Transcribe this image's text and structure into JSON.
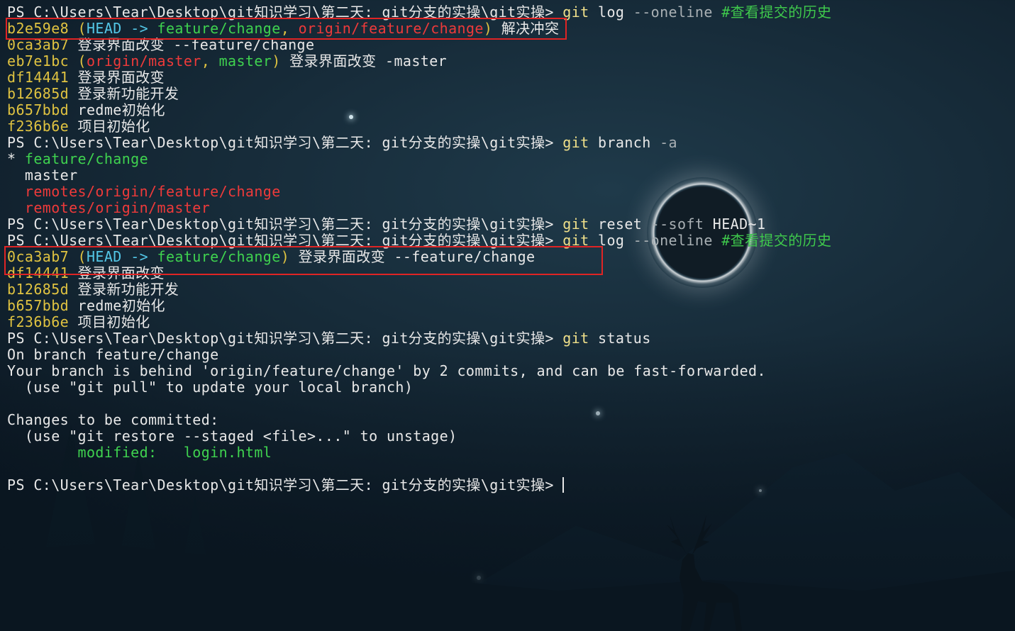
{
  "terminal": {
    "prompt": "PS C:\\Users\\Tear\\Desktop\\git知识学习\\第二天: git分支的实操\\git实操>",
    "lines": [
      {
        "type": "cmd",
        "cmd": "git",
        "args": " log",
        "param": " --oneline",
        "comment": " #查看提交的历史"
      },
      {
        "type": "log",
        "hash": "b2e59e8",
        "refs_open": " (",
        "head": "HEAD",
        "arrow": " -> ",
        "branch": "feature/change",
        "sep1": ", ",
        "remote1": "origin/feature/change",
        "refs_close": ")",
        "msg": " 解决冲突"
      },
      {
        "type": "plain_hash",
        "hash": "0ca3ab7",
        "msg": " 登录界面改变 --feature/change"
      },
      {
        "type": "log2",
        "hash": "eb7e1bc",
        "refs_open": " (",
        "remote": "origin/master",
        "sep": ", ",
        "local": "master",
        "refs_close": ")",
        "msg": " 登录界面改变 -master"
      },
      {
        "type": "plain_hash",
        "hash": "df14441",
        "msg": " 登录界面改变"
      },
      {
        "type": "plain_hash",
        "hash": "b12685d",
        "msg": " 登录新功能开发"
      },
      {
        "type": "plain_hash",
        "hash": "b657bbd",
        "msg": " redme初始化"
      },
      {
        "type": "plain_hash",
        "hash": "f236b6e",
        "msg": " 项目初始化"
      },
      {
        "type": "cmd",
        "cmd": "git",
        "args": " branch",
        "param": " -a",
        "comment": ""
      },
      {
        "type": "branch_current",
        "star": "* ",
        "name": "feature/change"
      },
      {
        "type": "branch_plain",
        "name": "  master"
      },
      {
        "type": "branch_remote",
        "name": "  remotes/origin/feature/change"
      },
      {
        "type": "branch_remote",
        "name": "  remotes/origin/master"
      },
      {
        "type": "cmd",
        "cmd": "git",
        "args": " reset",
        "param": " --soft",
        "extra": " HEAD~1",
        "comment": ""
      },
      {
        "type": "cmd",
        "cmd": "git",
        "args": " log",
        "param": " --oneline",
        "comment": " #查看提交的历史"
      },
      {
        "type": "log3",
        "hash": "0ca3ab7",
        "refs_open": " (",
        "head": "HEAD",
        "arrow": " -> ",
        "branch": "feature/change",
        "refs_close": ")",
        "msg": " 登录界面改变 --feature/change"
      },
      {
        "type": "plain_hash",
        "hash": "df14441",
        "msg": " 登录界面改变"
      },
      {
        "type": "plain_hash",
        "hash": "b12685d",
        "msg": " 登录新功能开发"
      },
      {
        "type": "plain_hash",
        "hash": "b657bbd",
        "msg": " redme初始化"
      },
      {
        "type": "plain_hash",
        "hash": "f236b6e",
        "msg": " 项目初始化"
      },
      {
        "type": "cmd",
        "cmd": "git",
        "args": " status",
        "param": "",
        "comment": ""
      },
      {
        "type": "text",
        "text": "On branch feature/change"
      },
      {
        "type": "text",
        "text": "Your branch is behind 'origin/feature/change' by 2 commits, and can be fast-forwarded."
      },
      {
        "type": "text",
        "text": "  (use \"git pull\" to update your local branch)"
      },
      {
        "type": "text",
        "text": ""
      },
      {
        "type": "text",
        "text": "Changes to be committed:"
      },
      {
        "type": "text",
        "text": "  (use \"git restore --staged <file>...\" to unstage)"
      },
      {
        "type": "modified",
        "label": "        modified:   ",
        "file": "login.html"
      },
      {
        "type": "text",
        "text": ""
      },
      {
        "type": "prompt_only"
      }
    ]
  },
  "colors": {
    "hash": "#e0c341",
    "head": "#53c6e6",
    "local_branch": "#3fd24f",
    "remote_branch": "#ee3a3a",
    "highlight_box": "#e02424"
  }
}
